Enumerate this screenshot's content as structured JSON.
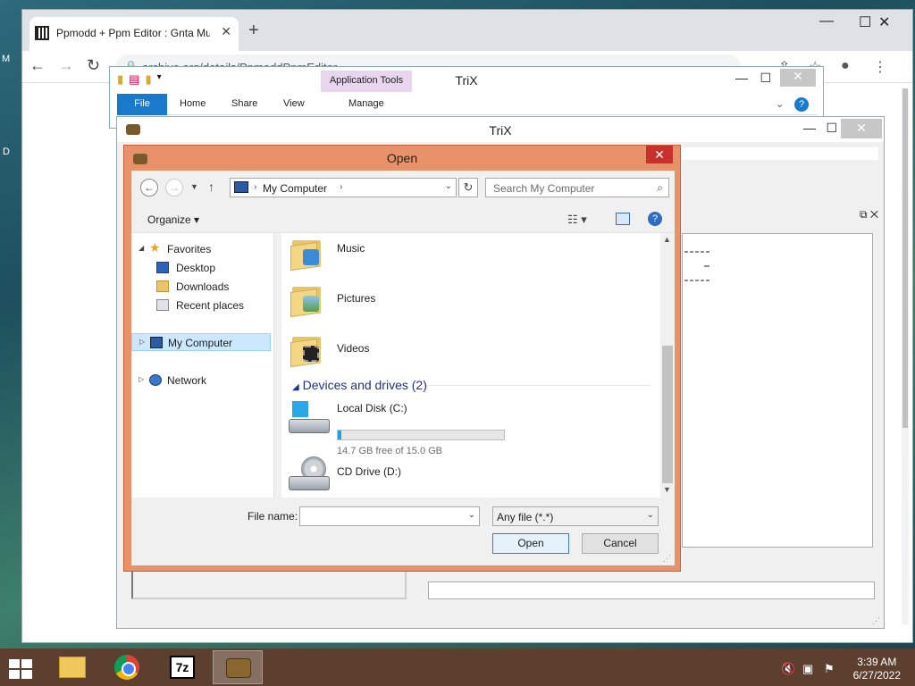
{
  "desktop": {
    "frag_m": "M",
    "frag_d": "D"
  },
  "browser": {
    "tab_title": "Ppmodd + Ppm Editor : Gnta Mu",
    "tab_close": "✕",
    "new_tab": "+",
    "url": "archive.org/details/PpmoddPpmEditor",
    "min": "—",
    "max": "☐",
    "close": "✕"
  },
  "explorer": {
    "title": "TriX",
    "context_tab": "Application Tools",
    "ribbon_tabs": [
      "File",
      "Home",
      "Share",
      "View",
      "Manage"
    ],
    "help": "?",
    "min": "—",
    "max": "☐",
    "close": "✕"
  },
  "trix": {
    "title": "TriX",
    "min": "—",
    "max": "☐",
    "close": "✕",
    "pane_ctrl": "⧉ ✕"
  },
  "dialog": {
    "title": "Open",
    "close": "✕",
    "address": "My Computer",
    "search_placeholder": "Search My Computer",
    "organize": "Organize ▾",
    "nav": {
      "favorites": "Favorites",
      "desktop": "Desktop",
      "downloads": "Downloads",
      "recent": "Recent places",
      "computer": "My Computer",
      "network": "Network"
    },
    "folders": [
      "Music",
      "Pictures",
      "Videos"
    ],
    "drives_group": "Devices and drives (2)",
    "drive_c": {
      "name": "Local Disk (C:)",
      "caption": "14.7 GB free of 15.0 GB",
      "used_fraction": 0.02
    },
    "drive_d": {
      "name": "CD Drive (D:)"
    },
    "filename_label": "File name:",
    "filename_value": "",
    "filter": "Any file (*.*)",
    "open_btn": "Open",
    "cancel_btn": "Cancel"
  },
  "taskbar": {
    "apps": [
      "windows-start",
      "file-explorer",
      "chrome",
      "7-zip",
      "trix"
    ],
    "time": "3:39 AM",
    "date": "6/27/2022"
  },
  "colors": {
    "dialog_frame": "#e8926a",
    "taskbar": "#5c3f2e",
    "accent": "#1979ca"
  }
}
